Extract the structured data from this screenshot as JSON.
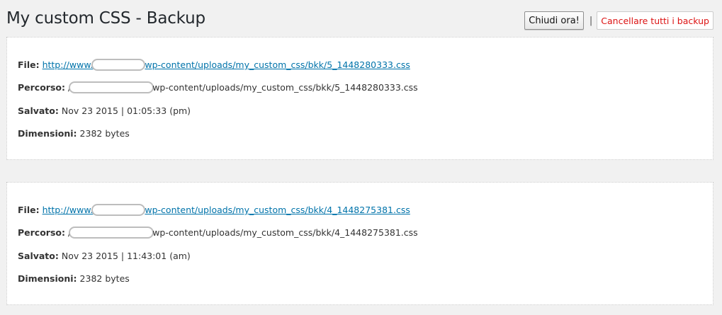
{
  "header": {
    "title": "My custom CSS - Backup",
    "close_label": "Chiudi ora!",
    "separator": "|",
    "delete_all_label": "Cancellare tutti i backup"
  },
  "labels": {
    "file": "File:",
    "path": "Percorso:",
    "saved": "Salvato:",
    "size": "Dimensioni:"
  },
  "backups": [
    {
      "file_prefix": "http://www.",
      "file_suffix": "wp-content/uploads/my_custom_css/bkk/5_1448280333.css",
      "path_prefix": "/",
      "path_suffix": "wp-content/uploads/my_custom_css/bkk/5_1448280333.css",
      "saved": "Nov 23 2015 | 01:05:33 (pm)",
      "size": "2382 bytes"
    },
    {
      "file_prefix": "http://www.",
      "file_suffix": "wp-content/uploads/my_custom_css/bkk/4_1448275381.css",
      "path_prefix": "/",
      "path_suffix": "wp-content/uploads/my_custom_css/bkk/4_1448275381.css",
      "saved": "Nov 23 2015 | 11:43:01 (am)",
      "size": "2382 bytes"
    }
  ],
  "colors": {
    "link": "#0073aa",
    "danger": "#dc1313",
    "background": "#f1f1f1"
  }
}
